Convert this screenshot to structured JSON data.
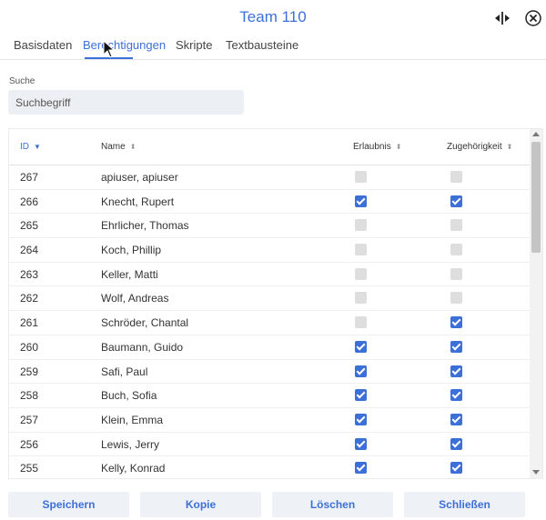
{
  "dialog": {
    "title": "Team 110"
  },
  "tabs": [
    {
      "label": "Basisdaten"
    },
    {
      "label": "Berechtigungen"
    },
    {
      "label": "Skripte"
    },
    {
      "label": "Textbausteine"
    }
  ],
  "active_tab": "Berechtigungen",
  "search": {
    "label": "Suche",
    "placeholder": "Suchbegriff",
    "value": ""
  },
  "table": {
    "columns": [
      {
        "label": "ID",
        "sort": "▼"
      },
      {
        "label": "Name",
        "sort": "⬍"
      },
      {
        "label": "Erlaubnis",
        "sort": "⬍"
      },
      {
        "label": "Zugehörigkeit",
        "sort": "⬍"
      }
    ],
    "rows": [
      {
        "id": "267",
        "name": "apiuser, apiuser",
        "erlaubnis": false,
        "zugehoerigkeit": false
      },
      {
        "id": "266",
        "name": "Knecht, Rupert",
        "erlaubnis": true,
        "zugehoerigkeit": true
      },
      {
        "id": "265",
        "name": "Ehrlicher, Thomas",
        "erlaubnis": false,
        "zugehoerigkeit": false
      },
      {
        "id": "264",
        "name": "Koch, Phillip",
        "erlaubnis": false,
        "zugehoerigkeit": false
      },
      {
        "id": "263",
        "name": "Keller, Matti",
        "erlaubnis": false,
        "zugehoerigkeit": false
      },
      {
        "id": "262",
        "name": "Wolf, Andreas",
        "erlaubnis": false,
        "zugehoerigkeit": false
      },
      {
        "id": "261",
        "name": "Schröder, Chantal",
        "erlaubnis": false,
        "zugehoerigkeit": true
      },
      {
        "id": "260",
        "name": "Baumann, Guido",
        "erlaubnis": true,
        "zugehoerigkeit": true
      },
      {
        "id": "259",
        "name": "Safi, Paul",
        "erlaubnis": true,
        "zugehoerigkeit": true
      },
      {
        "id": "258",
        "name": "Buch, Sofia",
        "erlaubnis": true,
        "zugehoerigkeit": true
      },
      {
        "id": "257",
        "name": "Klein, Emma",
        "erlaubnis": true,
        "zugehoerigkeit": true
      },
      {
        "id": "256",
        "name": "Lewis, Jerry",
        "erlaubnis": true,
        "zugehoerigkeit": true
      },
      {
        "id": "255",
        "name": "Kelly, Konrad",
        "erlaubnis": true,
        "zugehoerigkeit": true
      }
    ]
  },
  "footer": {
    "save_label": "Speichern",
    "copy_label": "Kopie",
    "delete_label": "Löschen",
    "close_label": "Schließen"
  },
  "icons": {
    "split": "split-view-icon",
    "close": "close-circle-icon",
    "sort_active": "sort-descending-icon",
    "sort": "sort-icon"
  },
  "colors": {
    "accent": "#3d6fd8",
    "checkbox_off": "#dedede",
    "button_bg": "#eef1f6",
    "input_bg": "#eceff3"
  }
}
